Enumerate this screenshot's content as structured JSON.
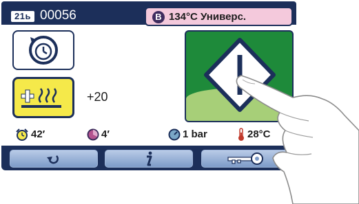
{
  "header": {
    "program_icon_text": "21ь",
    "program_number": "00056",
    "mode_badge": "B",
    "mode_text": "134°C Универс."
  },
  "controls": {
    "heat_offset": "+20"
  },
  "status": {
    "timer": "42′",
    "stage_time": "4′",
    "pressure": "1 bar",
    "temperature": "28°C"
  },
  "icons": {
    "timer_button": "timer-cycle-icon",
    "heat_button": "heating-plus-icon",
    "start_button": "start-diamond-icon",
    "alarm": "alarm-clock-icon",
    "stage": "stage-icon",
    "pressure": "pressure-gauge-icon",
    "temperature": "thermometer-icon",
    "back": "back-arrow-icon",
    "info": "info-icon",
    "key": "key-icon"
  },
  "colors": {
    "frame": "#1c2f5a",
    "mode_panel": "#f4c9dc",
    "start_green": "#1e8a3a",
    "start_light_green": "#a7cf78",
    "heat_yellow": "#f5e94a",
    "button_blue": "#9fb6da"
  }
}
